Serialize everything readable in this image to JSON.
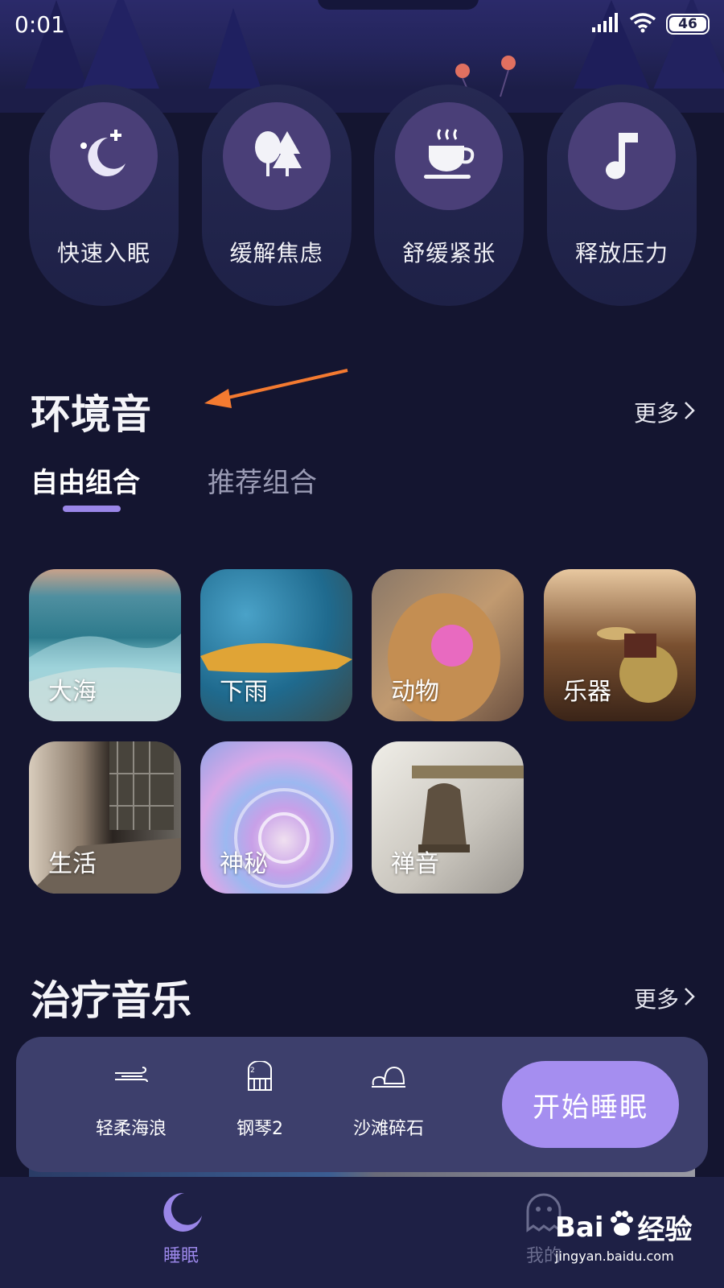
{
  "status_bar": {
    "time": "0:01",
    "battery": "46"
  },
  "categories": [
    {
      "label": "快速入眠",
      "icon": "moon-star-icon"
    },
    {
      "label": "缓解焦虑",
      "icon": "trees-icon"
    },
    {
      "label": "舒缓紧张",
      "icon": "coffee-cup-icon"
    },
    {
      "label": "释放压力",
      "icon": "music-note-icon"
    }
  ],
  "ambient": {
    "title": "环境音",
    "more": "更多",
    "tabs": [
      {
        "label": "自由组合",
        "active": true
      },
      {
        "label": "推荐组合",
        "active": false
      }
    ],
    "tiles": [
      {
        "label": "大海"
      },
      {
        "label": "下雨"
      },
      {
        "label": "动物"
      },
      {
        "label": "乐器"
      },
      {
        "label": "生活"
      },
      {
        "label": "神秘"
      },
      {
        "label": "禅音"
      }
    ]
  },
  "therapy": {
    "title": "治疗音乐",
    "more": "更多"
  },
  "player": {
    "items": [
      {
        "label": "轻柔海浪",
        "icon": "wave-wind-icon"
      },
      {
        "label": "钢琴2",
        "icon": "piano-icon"
      },
      {
        "label": "沙滩碎石",
        "icon": "pebbles-icon"
      }
    ],
    "start_label": "开始睡眠"
  },
  "nav": {
    "items": [
      {
        "label": "睡眠",
        "icon": "moon-icon",
        "active": true
      },
      {
        "label": "我的",
        "icon": "ghost-profile-icon",
        "active": false
      }
    ]
  },
  "watermark": {
    "brand": "Bai",
    "brand2": "经验",
    "url": "jingyan.baidu.com"
  },
  "colors": {
    "background": "#141530",
    "accent": "#9a86e8",
    "button": "#a58ef0",
    "annotation_arrow": "#f47a30"
  }
}
